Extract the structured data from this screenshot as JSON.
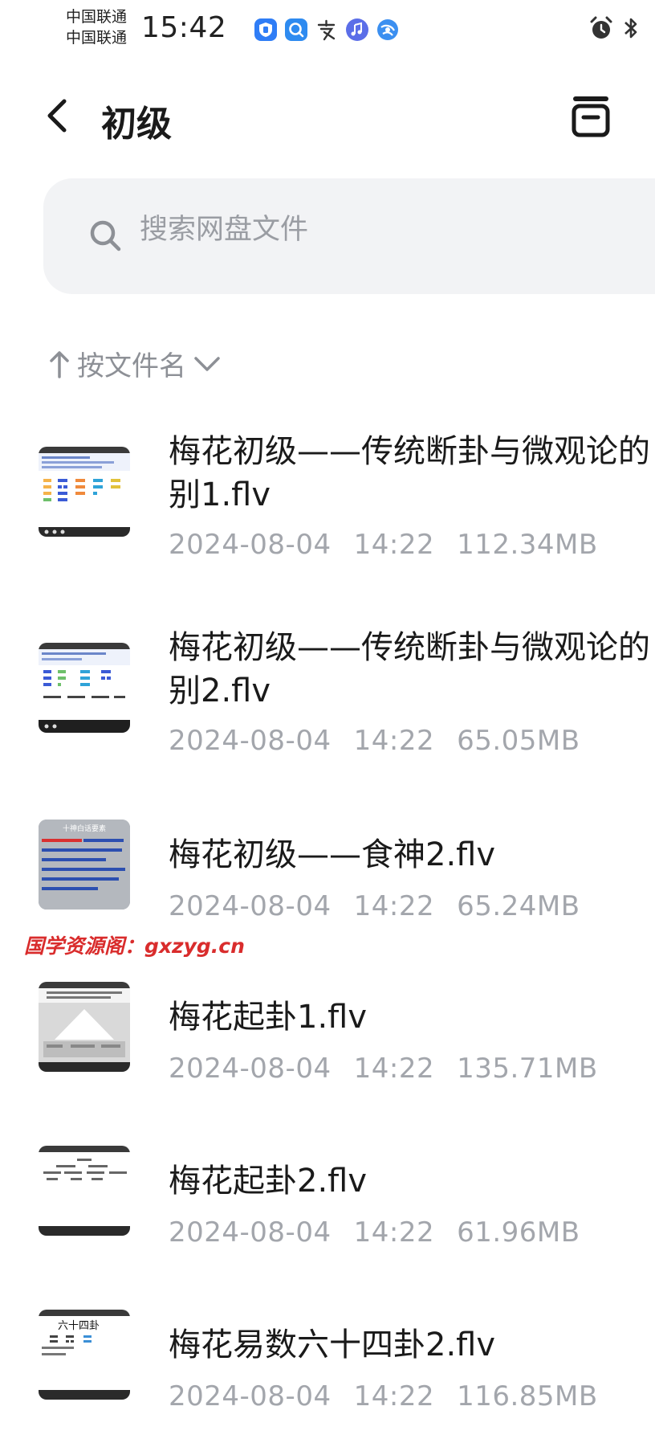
{
  "status_bar": {
    "carrier_1": "中国联通",
    "carrier_2": "中国联通",
    "time": "15:42"
  },
  "header": {
    "title": "初级",
    "back_icon": "chevron-left-icon",
    "action_icon": "archive-box-icon"
  },
  "search": {
    "placeholder": "搜索网盘文件"
  },
  "sort": {
    "label": "按文件名"
  },
  "files": [
    {
      "name_line1": "梅花初级——传统断卦与微观论的",
      "name_line2": "别1.flv",
      "date": "2024-08-04",
      "time": "14:22",
      "size": "112.34MB"
    },
    {
      "name_line1": "梅花初级——传统断卦与微观论的",
      "name_line2": "别2.flv",
      "date": "2024-08-04",
      "time": "14:22",
      "size": "65.05MB"
    },
    {
      "name_line1": "梅花初级——食神2.flv",
      "name_line2": "",
      "date": "2024-08-04",
      "time": "14:22",
      "size": "65.24MB"
    },
    {
      "name_line1": "梅花起卦1.flv",
      "name_line2": "",
      "date": "2024-08-04",
      "time": "14:22",
      "size": "135.71MB"
    },
    {
      "name_line1": "梅花起卦2.flv",
      "name_line2": "",
      "date": "2024-08-04",
      "time": "14:22",
      "size": "61.96MB"
    },
    {
      "name_line1": "梅花易数六十四卦2.flv",
      "name_line2": "",
      "date": "2024-08-04",
      "time": "14:22",
      "size": "116.85MB"
    }
  ],
  "thumbnails": {
    "t3_heading": "十神白话要素",
    "t6_heading": "六十四卦"
  },
  "watermark": "国学资源阁：gxzyg.cn",
  "colors": {
    "accent_text": "#1a1a1a",
    "meta_text": "#a3a6ac",
    "search_bg": "#f2f3f5",
    "watermark": "#d92c2c"
  }
}
